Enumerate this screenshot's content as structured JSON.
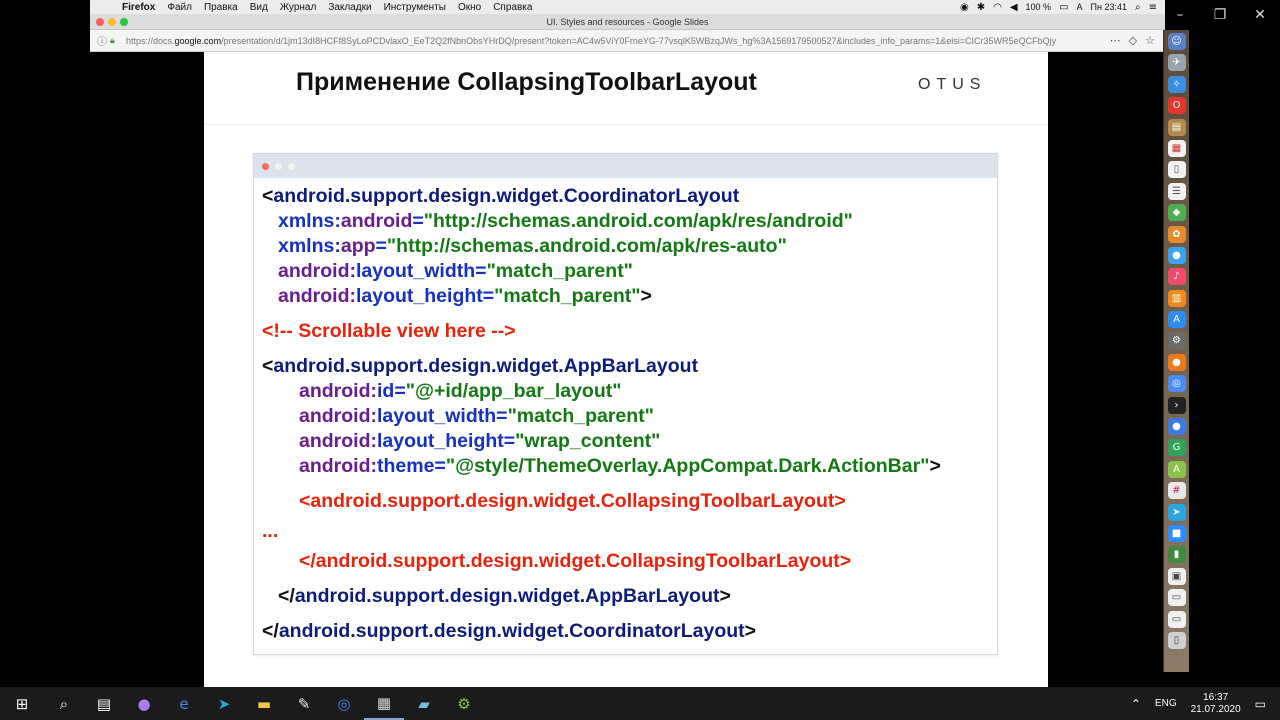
{
  "menubar": {
    "app": "Firefox",
    "items": [
      "Файл",
      "Правка",
      "Вид",
      "Журнал",
      "Закладки",
      "Инструменты",
      "Окно",
      "Справка"
    ],
    "battery": "100 %",
    "clock": "Пн 23:41",
    "input_lang": "A"
  },
  "browser": {
    "window_title": "UI. Styles and resources - Google Slides",
    "url_prefix": "https://docs.",
    "url_domain": "google.com",
    "url_rest": "/presentation/d/1jm13dI8HCFf8SyLoPCDvlaxO_EeT2Q2fNbnObsYHrDQ/present?token=AC4w5ViY0FrneYG-77vsqlK5WBzqJWs_hg%3A1569179500527&includes_info_params=1&eisi=CICr35WR5eQCFbQjy"
  },
  "slide": {
    "title": "Применение CollapsingToolbarLayout",
    "logo": "OTUS",
    "code": {
      "l1_open": "<",
      "l1_tag": "android.support.design.widget.CoordinatorLayout",
      "l2_a": "xmlns:",
      "l2_b": "android",
      "l2_c": "=",
      "l2_v": "\"http://schemas.android.com/apk/res/android\"",
      "l3_a": "xmlns:",
      "l3_b": "app",
      "l3_c": "=",
      "l3_v": "\"http://schemas.android.com/apk/res-auto\"",
      "l4_ns": "android:",
      "l4_attr": "layout_width=",
      "l4_v": "\"match_parent\"",
      "l5_ns": "android:",
      "l5_attr": "layout_height=",
      "l5_v": "\"match_parent\"",
      "l5_end": ">",
      "comment": "<!-- Scrollable view here -->",
      "l7_open": "<",
      "l7_tag": "android.support.design.widget.AppBarLayout",
      "l8_ns": "android:",
      "l8_attr": "id=",
      "l8_v": "\"@+id/app_bar_layout\"",
      "l9_ns": "android:",
      "l9_attr": "layout_width=",
      "l9_v": "\"match_parent\"",
      "l10_ns": "android:",
      "l10_attr": "layout_height=",
      "l10_v": "\"wrap_content\"",
      "l11_ns": "android:",
      "l11_attr": "theme=",
      "l11_v": "\"@style/ThemeOverlay.AppCompat.Dark.ActionBar\"",
      "l11_end": ">",
      "ctl_open": "<android.support.design.widget.CollapsingToolbarLayout>",
      "ellipsis": "...",
      "ctl_close": "</android.support.design.widget.CollapsingToolbarLayout>",
      "abl_close_a": "</",
      "abl_close_tag": "android.support.design.widget.AppBarLayout",
      "abl_close_b": ">",
      "cl_close_a": "</",
      "cl_close_tag": "android.support.design.widget.CoordinatorLayout",
      "cl_close_b": ">"
    }
  },
  "taskbar": {
    "lang": "ENG",
    "time": "16:37",
    "date": "21.07.2020"
  },
  "colors": {
    "tag": "#0d1c7a",
    "xmlns": "#1431c4",
    "namespace": "#6a1d8e",
    "value": "#137a13",
    "comment": "#e8230c"
  }
}
